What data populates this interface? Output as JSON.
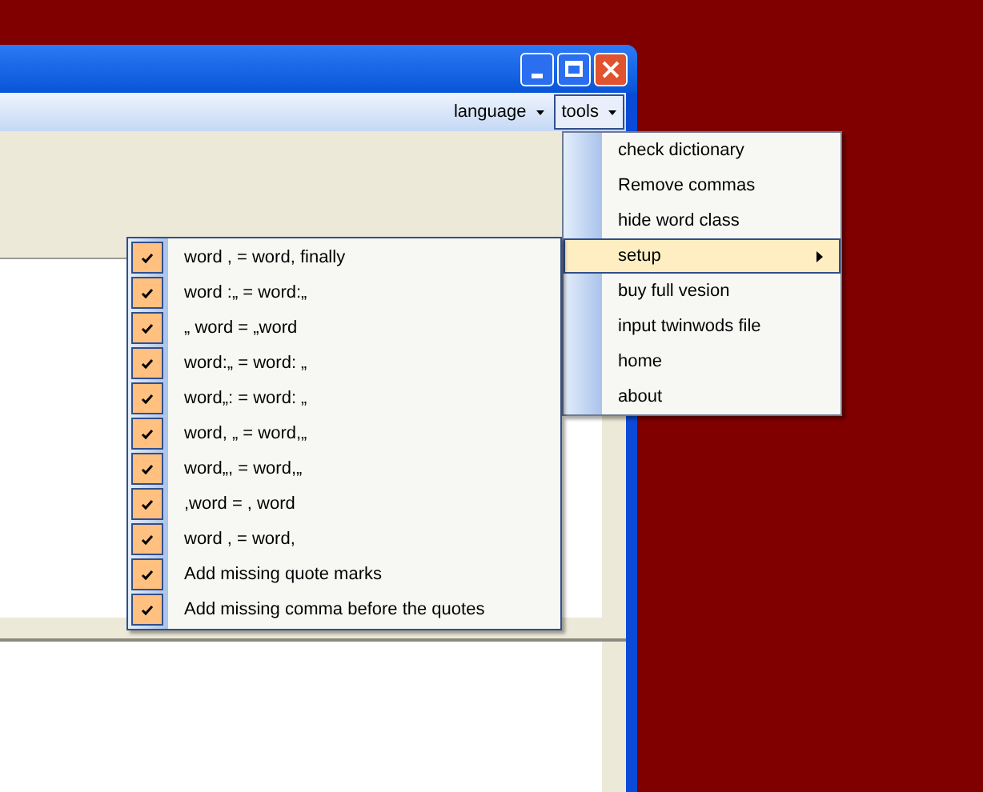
{
  "menubar": [
    {
      "label": "language",
      "selected": false
    },
    {
      "label": "tools",
      "selected": true
    }
  ],
  "tools_menu": [
    {
      "label": "check dictionary",
      "kind": "item",
      "selected": false
    },
    {
      "label": "Remove commas",
      "kind": "item",
      "selected": false
    },
    {
      "label": "hide word class",
      "kind": "item",
      "selected": false
    },
    {
      "label": "setup",
      "kind": "submenu",
      "selected": true
    },
    {
      "label": "buy full vesion",
      "kind": "item",
      "selected": false
    },
    {
      "label": "input twinwods file",
      "kind": "item",
      "selected": false
    },
    {
      "label": "home",
      "kind": "item",
      "selected": false
    },
    {
      "label": "about",
      "kind": "item",
      "selected": false
    }
  ],
  "setup_menu": [
    {
      "label": "word , = word, finally",
      "checked": true
    },
    {
      "label": "word :„ = word:„",
      "checked": true
    },
    {
      "label": "„ word = „word",
      "checked": true
    },
    {
      "label": "word:„ = word: „",
      "checked": true
    },
    {
      "label": "word„: = word: „",
      "checked": true
    },
    {
      "label": "word, „ = word,„",
      "checked": true
    },
    {
      "label": "word„, = word,„",
      "checked": true
    },
    {
      "label": ",word = , word",
      "checked": true
    },
    {
      "label": "word , = word,",
      "checked": true
    },
    {
      "label": "Add missing quote marks",
      "checked": true
    },
    {
      "label": "Add missing comma before the quotes",
      "checked": true
    }
  ]
}
